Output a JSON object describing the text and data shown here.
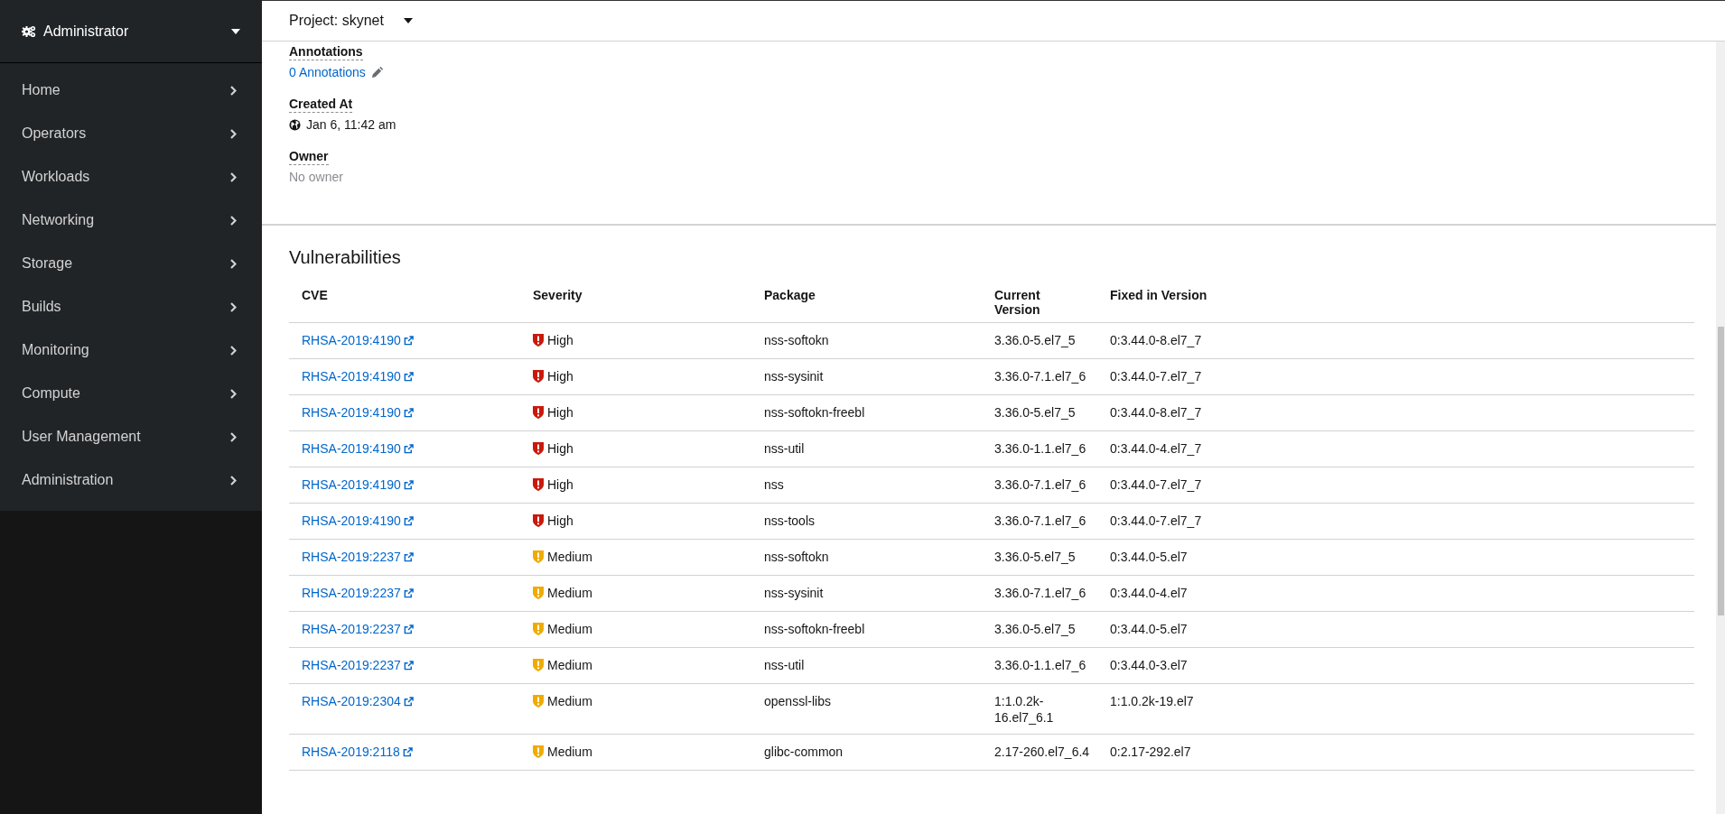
{
  "sidebar": {
    "perspective": "Administrator",
    "items": [
      {
        "label": "Home"
      },
      {
        "label": "Operators"
      },
      {
        "label": "Workloads"
      },
      {
        "label": "Networking"
      },
      {
        "label": "Storage"
      },
      {
        "label": "Builds"
      },
      {
        "label": "Monitoring"
      },
      {
        "label": "Compute"
      },
      {
        "label": "User Management"
      },
      {
        "label": "Administration"
      }
    ]
  },
  "header": {
    "project": "Project: skynet"
  },
  "details": [
    {
      "label": "Annotations",
      "value": "0 Annotations",
      "kind": "link"
    },
    {
      "label": "Created At",
      "value": "Jan 6, 11:42 am",
      "kind": "timestamp"
    },
    {
      "label": "Owner",
      "value": "No owner",
      "kind": "empty"
    }
  ],
  "vulnerabilities": {
    "title": "Vulnerabilities",
    "columns": [
      "CVE",
      "Severity",
      "Package",
      "Current Version",
      "Fixed in Version"
    ],
    "rows": [
      {
        "cve": "RHSA-2019:4190",
        "severity": "High",
        "kind": "high",
        "package": "nss-softokn",
        "current": "3.36.0-5.el7_5",
        "fixed": "0:3.44.0-8.el7_7"
      },
      {
        "cve": "RHSA-2019:4190",
        "severity": "High",
        "kind": "high",
        "package": "nss-sysinit",
        "current": "3.36.0-7.1.el7_6",
        "fixed": "0:3.44.0-7.el7_7"
      },
      {
        "cve": "RHSA-2019:4190",
        "severity": "High",
        "kind": "high",
        "package": "nss-softokn-freebl",
        "current": "3.36.0-5.el7_5",
        "fixed": "0:3.44.0-8.el7_7"
      },
      {
        "cve": "RHSA-2019:4190",
        "severity": "High",
        "kind": "high",
        "package": "nss-util",
        "current": "3.36.0-1.1.el7_6",
        "fixed": "0:3.44.0-4.el7_7"
      },
      {
        "cve": "RHSA-2019:4190",
        "severity": "High",
        "kind": "high",
        "package": "nss",
        "current": "3.36.0-7.1.el7_6",
        "fixed": "0:3.44.0-7.el7_7"
      },
      {
        "cve": "RHSA-2019:4190",
        "severity": "High",
        "kind": "high",
        "package": "nss-tools",
        "current": "3.36.0-7.1.el7_6",
        "fixed": "0:3.44.0-7.el7_7"
      },
      {
        "cve": "RHSA-2019:2237",
        "severity": "Medium",
        "kind": "medium",
        "package": "nss-softokn",
        "current": "3.36.0-5.el7_5",
        "fixed": "0:3.44.0-5.el7"
      },
      {
        "cve": "RHSA-2019:2237",
        "severity": "Medium",
        "kind": "medium",
        "package": "nss-sysinit",
        "current": "3.36.0-7.1.el7_6",
        "fixed": "0:3.44.0-4.el7"
      },
      {
        "cve": "RHSA-2019:2237",
        "severity": "Medium",
        "kind": "medium",
        "package": "nss-softokn-freebl",
        "current": "3.36.0-5.el7_5",
        "fixed": "0:3.44.0-5.el7"
      },
      {
        "cve": "RHSA-2019:2237",
        "severity": "Medium",
        "kind": "medium",
        "package": "nss-util",
        "current": "3.36.0-1.1.el7_6",
        "fixed": "0:3.44.0-3.el7"
      },
      {
        "cve": "RHSA-2019:2304",
        "severity": "Medium",
        "kind": "medium",
        "package": "openssl-libs",
        "current": "1:1.0.2k-16.el7_6.1",
        "fixed": "1:1.0.2k-19.el7"
      },
      {
        "cve": "RHSA-2019:2118",
        "severity": "Medium",
        "kind": "medium",
        "package": "glibc-common",
        "current": "2.17-260.el7_6.4",
        "fixed": "0:2.17-292.el7"
      }
    ]
  }
}
